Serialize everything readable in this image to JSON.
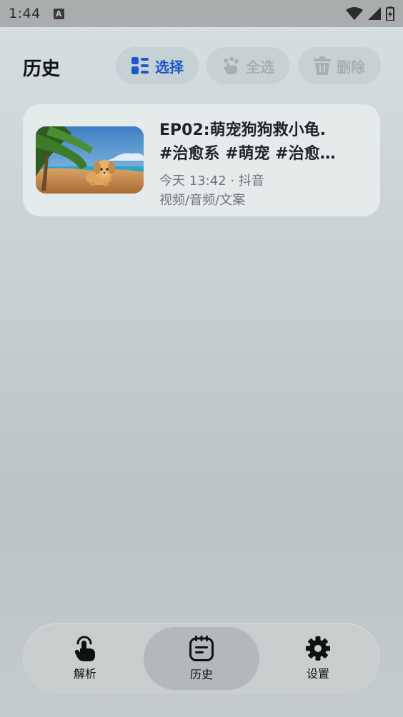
{
  "status_bar": {
    "time": "1:44",
    "notification_icon": "A"
  },
  "header": {
    "title": "历史",
    "select_label": "选择",
    "select_all_label": "全选",
    "delete_label": "删除"
  },
  "history": [
    {
      "title_line1": "EP02:萌宠狗狗救小龟.",
      "title_line2": "#治愈系 #萌宠 #治愈…",
      "time_source": "今天 13:42 · 抖音",
      "types": "视频/音频/文案"
    }
  ],
  "bottom_nav": {
    "items": [
      {
        "label": "解析",
        "icon": "tap-hand-icon"
      },
      {
        "label": "历史",
        "icon": "calendar-notes-icon"
      },
      {
        "label": "设置",
        "icon": "gear-icon"
      }
    ],
    "active": "历史"
  },
  "colors": {
    "accent": "#1e58c8",
    "disabled": "#a7afb2"
  }
}
